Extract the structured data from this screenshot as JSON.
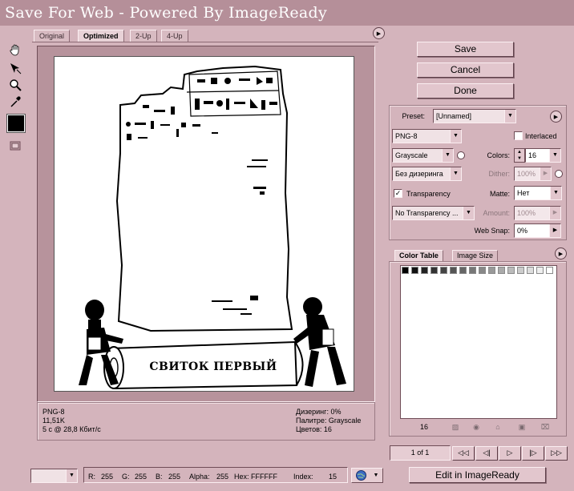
{
  "window": {
    "title": "Save For Web - Powered By ImageReady"
  },
  "tabs": [
    {
      "label": "Original"
    },
    {
      "label": "Optimized"
    },
    {
      "label": "2-Up"
    },
    {
      "label": "4-Up"
    }
  ],
  "image": {
    "caption": "СВИТОК ПЕРВЫЙ"
  },
  "info": {
    "format": "PNG-8",
    "size": "11,51K",
    "time": "5 с @ 28,8 Кбит/с",
    "dither": "Дизеринг: 0%",
    "palette": "Палитре: Grayscale",
    "colors": "Цветов: 16"
  },
  "actions": {
    "save": "Save",
    "cancel": "Cancel",
    "done": "Done"
  },
  "settings": {
    "preset_label": "Preset:",
    "preset_value": "[Unnamed]",
    "format_value": "PNG-8",
    "interlaced_label": "Interlaced",
    "reduction_value": "Grayscale",
    "colors_label": "Colors:",
    "colors_value": "16",
    "dither_algo_value": "Без дизеринга",
    "dither_label": "Dither:",
    "dither_value": "100%",
    "transparency_label": "Transparency",
    "matte_label": "Matte:",
    "matte_value": "Нет",
    "trans_dither_value": "No Transparency ...",
    "amount_label": "Amount:",
    "amount_value": "100%",
    "websnap_label": "Web Snap:",
    "websnap_value": "0%"
  },
  "color_table": {
    "tabs": [
      {
        "label": "Color Table"
      },
      {
        "label": "Image Size"
      }
    ],
    "count": "16"
  },
  "frames": {
    "label": "1 of 1"
  },
  "status": {
    "r_label": "R:",
    "r_value": "255",
    "g_label": "G:",
    "g_value": "255",
    "b_label": "B:",
    "b_value": "255",
    "alpha_label": "Alpha:",
    "alpha_value": "255",
    "hex_label": "Hex:",
    "hex_value": "FFFFFF",
    "index_label": "Index:",
    "index_value": "15"
  },
  "edit_button": "Edit in ImageReady",
  "colors": {
    "background": "#d4b4bc",
    "titlebar": "#b58f99",
    "preview_frame": "#b7939c"
  }
}
